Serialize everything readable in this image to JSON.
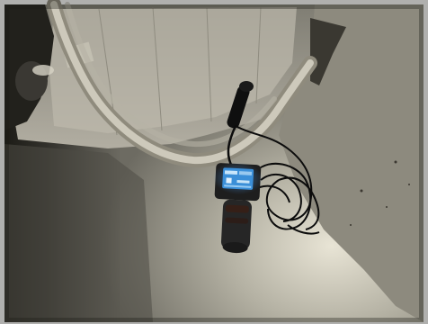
{
  "scene": {
    "colors": {
      "wall_light": "#d6d2c4",
      "wall_dark": "#1b1a15",
      "ceiling_panel": "#a9a69a",
      "hose": "#c8c4b6",
      "meter_body": "#262626",
      "meter_screen": "#3b8fd8",
      "cable": "#0c0c0c"
    },
    "meter_icon": "moisture-meter-icon",
    "probe_icon": "probe-icon"
  }
}
